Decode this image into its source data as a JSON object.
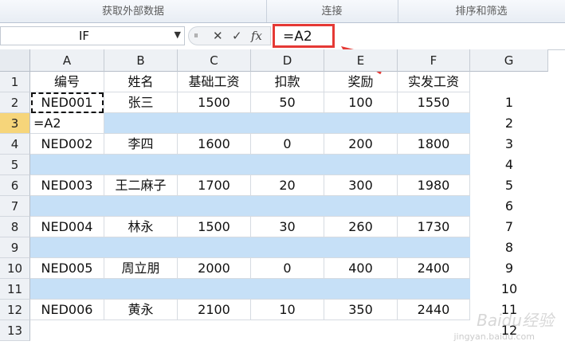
{
  "ribbon": {
    "groups": [
      "获取外部数据",
      "连接",
      "排序和筛选"
    ]
  },
  "formula_bar": {
    "name_box": "IF",
    "cancel_glyph": "✕",
    "enter_glyph": "✓",
    "fx_glyph": "fx",
    "formula": "=A2"
  },
  "columns": [
    "A",
    "B",
    "C",
    "D",
    "E",
    "F",
    "G"
  ],
  "rows": [
    "1",
    "2",
    "3",
    "4",
    "5",
    "6",
    "7",
    "8",
    "9",
    "10",
    "11",
    "12",
    "13"
  ],
  "header_row": [
    "编号",
    "姓名",
    "基础工资",
    "扣款",
    "奖励",
    "实发工资"
  ],
  "data": [
    [
      "NED001",
      "张三",
      "1500",
      "50",
      "100",
      "1550"
    ],
    [
      "NED002",
      "李四",
      "1600",
      "0",
      "200",
      "1800"
    ],
    [
      "NED003",
      "王二麻子",
      "1700",
      "20",
      "300",
      "1980"
    ],
    [
      "NED004",
      "林永",
      "1500",
      "30",
      "260",
      "1730"
    ],
    [
      "NED005",
      "周立朋",
      "2000",
      "0",
      "400",
      "2400"
    ],
    [
      "NED006",
      "黄永",
      "2100",
      "10",
      "350",
      "2440"
    ]
  ],
  "editing_cell": "=A2",
  "g_values": [
    "1",
    "2",
    "3",
    "4",
    "5",
    "6",
    "7",
    "8",
    "9",
    "10",
    "11",
    "12"
  ],
  "colors": {
    "highlight_row": "#c6e0f7",
    "callout": "#e53935"
  },
  "watermark": {
    "text": "Baidu经验",
    "sub": "jingyan.baidu.com"
  }
}
